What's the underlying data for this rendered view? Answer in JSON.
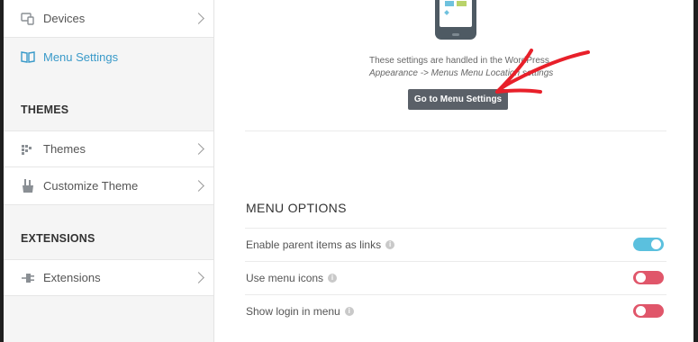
{
  "sidebar": {
    "items": [
      {
        "label": "Devices",
        "icon": "devices-icon"
      },
      {
        "label": "Menu Settings",
        "icon": "book-icon"
      },
      {
        "label": "Themes",
        "icon": "themes-icon"
      },
      {
        "label": "Customize Theme",
        "icon": "brush-cup-icon"
      },
      {
        "label": "Extensions",
        "icon": "plug-icon"
      }
    ],
    "sections": [
      "THEMES",
      "EXTENSIONS"
    ]
  },
  "main": {
    "info_line1": "These settings are handled in the WordPress",
    "info_line2": "Appearance -> Menus Menu Location settings",
    "goto_button": "Go to Menu Settings",
    "menu_options_title": "MENU OPTIONS",
    "options": [
      {
        "label": "Enable parent items as links",
        "enabled": true
      },
      {
        "label": "Use menu icons",
        "enabled": false
      },
      {
        "label": "Show login in menu",
        "enabled": false
      }
    ]
  },
  "colors": {
    "accent": "#3a9ac9",
    "toggle_on": "#5bc0de",
    "toggle_off": "#e0566a",
    "annotation": "#e8202a"
  }
}
